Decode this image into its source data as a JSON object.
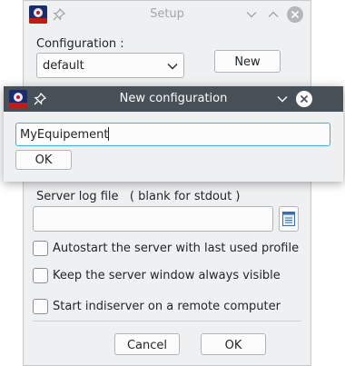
{
  "setup_window": {
    "title": "Setup",
    "configuration_label": "Configuration :",
    "configuration_value": "default",
    "new_button": "New",
    "server_log_label": "Server log file   ( blank for stdout )",
    "server_log_value": "",
    "options": [
      {
        "label": "Autostart the server with last used profile",
        "checked": false
      },
      {
        "label": "Keep the server window always visible",
        "checked": false
      },
      {
        "label": "Start indiserver on a remote computer",
        "checked": false
      }
    ],
    "cancel_button": "Cancel",
    "ok_button": "OK"
  },
  "dialog": {
    "title": "New configuration",
    "input_value": "MyEquipement",
    "ok_button": "OK"
  },
  "colors": {
    "window_bg": "#eff0f1",
    "dialog_titlebar": "#475057",
    "focus_accent": "#3daee9"
  }
}
